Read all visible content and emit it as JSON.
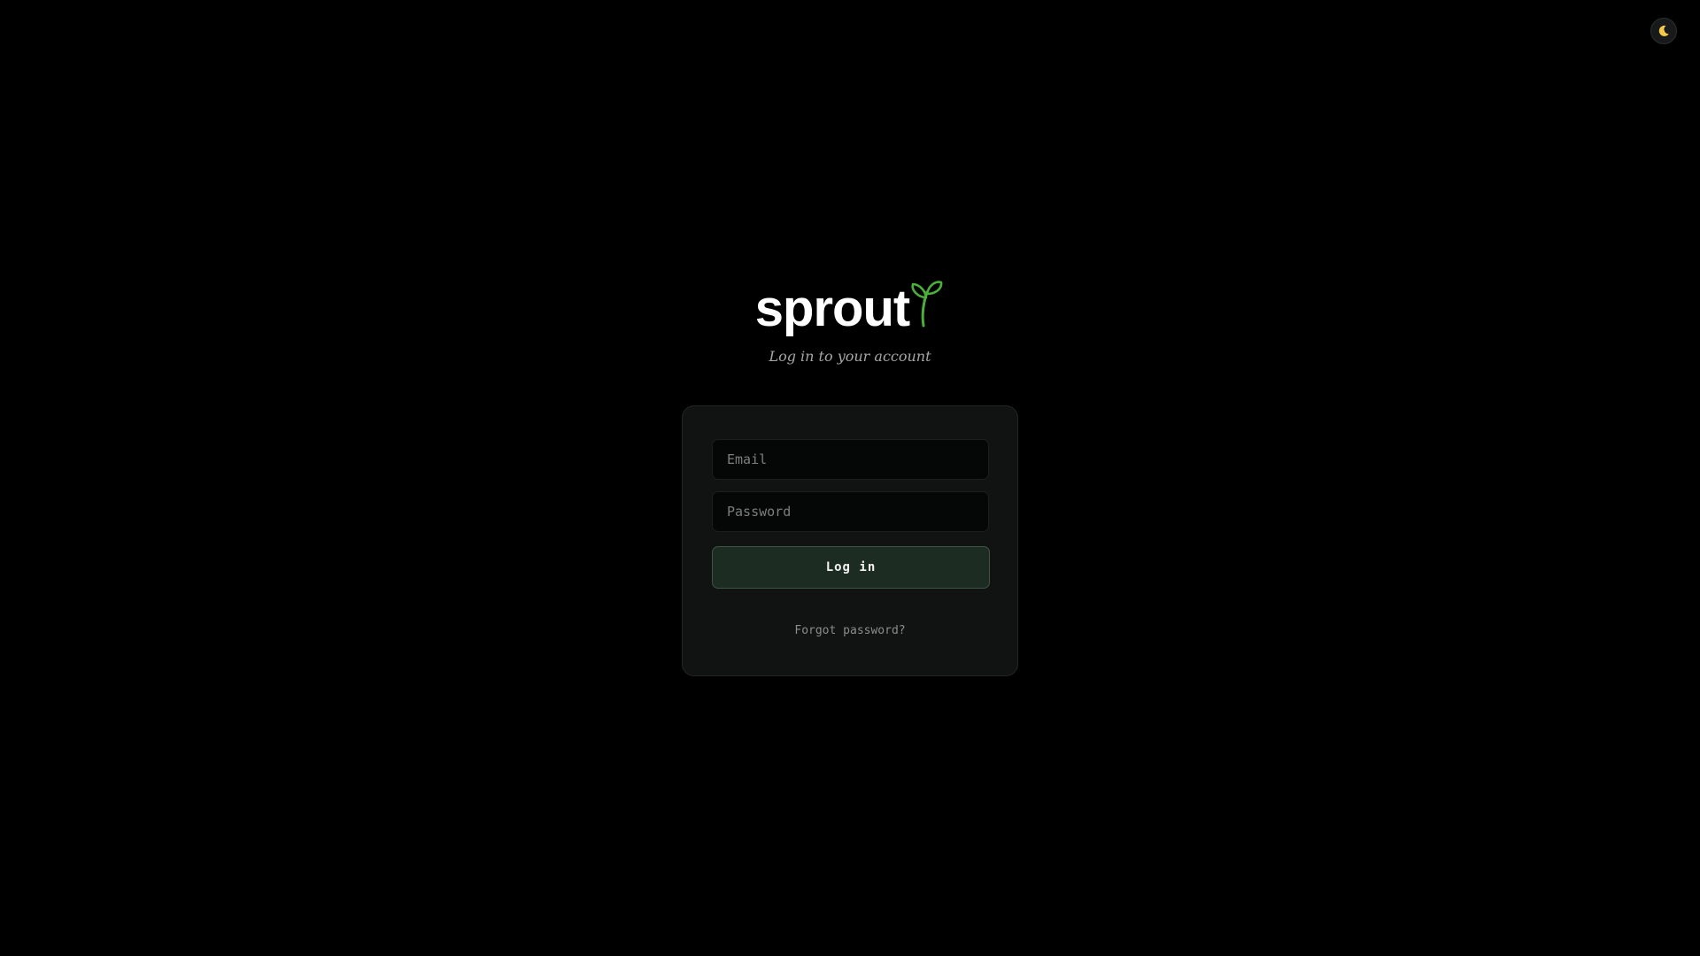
{
  "app": {
    "logo_text": "sprout",
    "subtitle": "Log in to your account",
    "accent_color": "#4caf3a"
  },
  "theme_toggle": {
    "icon": "moon-icon",
    "icon_color": "#f2c94c"
  },
  "login_form": {
    "email_placeholder": "Email",
    "email_value": "",
    "password_placeholder": "Password",
    "password_value": "",
    "submit_label": "Log in",
    "forgot_password_label": "Forgot password?"
  }
}
